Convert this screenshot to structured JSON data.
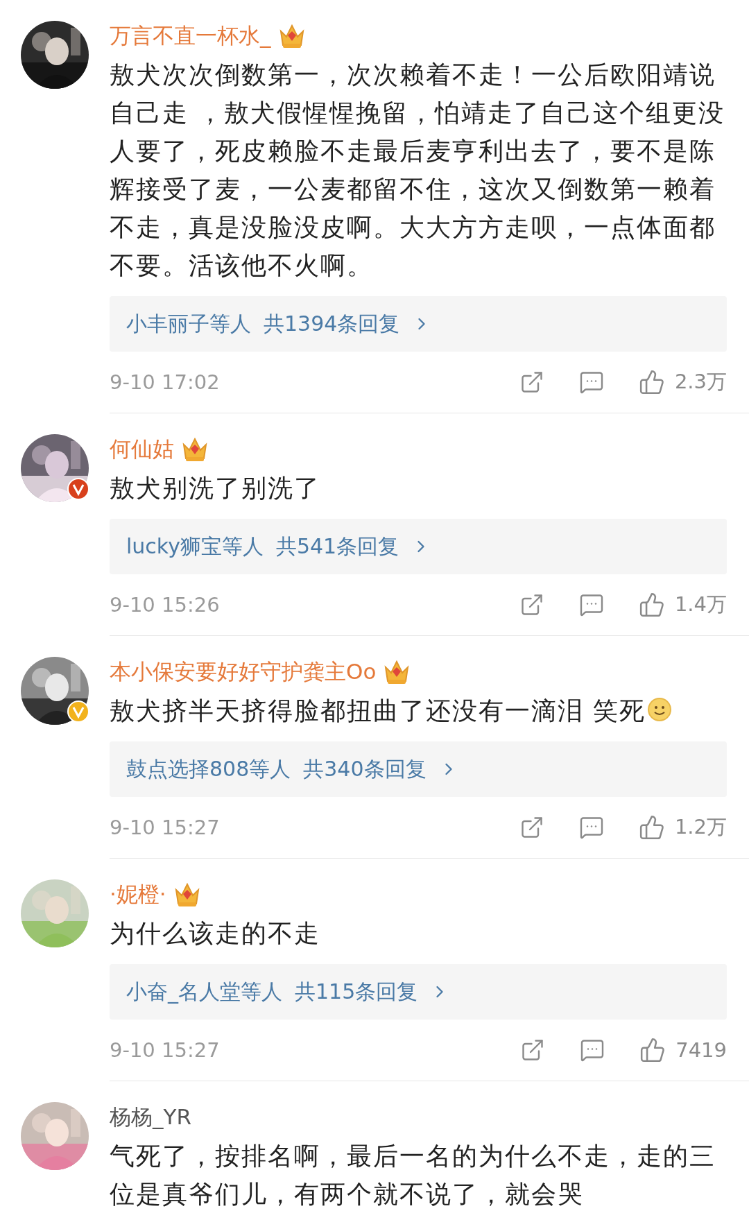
{
  "comments": [
    {
      "username": "万言不直一杯水_",
      "vip": true,
      "text": "敖犬次次倒数第一，次次赖着不走！一公后欧阳靖说自己走 ，敖犬假惺惺挽留，怕靖走了自己这个组更没人要了，死皮赖脸不走最后麦亨利出去了，要不是陈辉接受了麦，一公麦都留不住，这次又倒数第一赖着不走，真是没脸没皮啊。大大方方走呗，一点体面都不要。活该他不火啊。",
      "emoji": false,
      "replies": {
        "users": "小丰丽子等人",
        "count": "共1394条回复"
      },
      "time": "9-10 17:02",
      "likes": "2.3万"
    },
    {
      "username": "何仙姑",
      "vip": true,
      "badge": {
        "color": "#d8401c"
      },
      "text": "敖犬别洗了别洗了",
      "emoji": false,
      "replies": {
        "users": "lucky狮宝等人",
        "count": "共541条回复"
      },
      "time": "9-10 15:26",
      "likes": "1.4万"
    },
    {
      "username": "本小保安要好好守护龚主Oo",
      "vip": true,
      "badge": {
        "color": "#f2b21c"
      },
      "text": "敖犬挤半天挤得脸都扭曲了还没有一滴泪 笑死",
      "emoji": true,
      "replies": {
        "users": "鼓点选择808等人",
        "count": "共340条回复"
      },
      "time": "9-10 15:27",
      "likes": "1.2万"
    },
    {
      "username": "·妮橙·",
      "vip": true,
      "text": "为什么该走的不走",
      "emoji": false,
      "replies": {
        "users": "小奋_名人堂等人",
        "count": "共115条回复"
      },
      "time": "9-10 15:27",
      "likes": "7419"
    },
    {
      "username": "杨杨_YR",
      "vip": false,
      "text": "气死了，按排名啊，最后一名的为什么不走，走的三位是真爷们儿，有两个就不说了，就会哭",
      "emoji": false
    }
  ]
}
